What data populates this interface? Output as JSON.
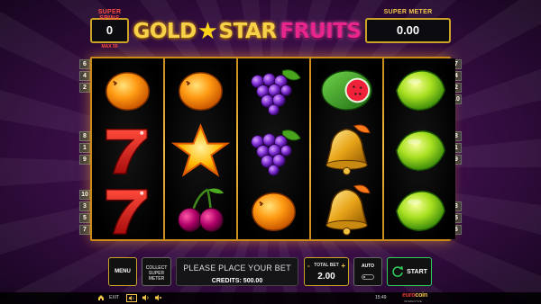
{
  "header": {
    "super_spins_label": "SUPER SPINS",
    "super_spins_value": "0",
    "max_spins_note": "MAX 50",
    "logo_part1": "GOLD",
    "logo_star": "★",
    "logo_part2": "STAR",
    "logo_part3": "FRUITS",
    "super_meter_label": "SUPER METER",
    "super_meter_value": "0.00"
  },
  "paylines": {
    "left": [
      "6",
      "4",
      "2",
      "8",
      "1",
      "9",
      "10",
      "3",
      "5",
      "7"
    ],
    "right": [
      "7",
      "4",
      "2",
      "10",
      "8",
      "1",
      "9",
      "3",
      "5",
      "6"
    ]
  },
  "reels": [
    [
      "orange",
      "seven",
      "seven"
    ],
    [
      "orange",
      "star",
      "cherries"
    ],
    [
      "grapes",
      "grapes",
      "orange"
    ],
    [
      "watermelon",
      "bell",
      "bell"
    ],
    [
      "lemon",
      "lemon",
      "lemon"
    ]
  ],
  "controls": {
    "menu_label": "MENU",
    "collect_label_1": "COLLECT",
    "collect_label_2": "SUPER",
    "collect_label_3": "METER",
    "message": "PLEASE PLACE YOUR BET",
    "credits_label": "CREDITS:",
    "credits_value": "500.00",
    "total_bet_label": "TOTAL BET",
    "bet_minus": "-",
    "bet_plus": "+",
    "total_bet_value": "2.00",
    "auto_label": "AUTO",
    "start_label": "START"
  },
  "status_bar": {
    "home_icon": "home-icon",
    "exit_label": "EXIT",
    "sound_icon": "speaker-icon",
    "time": "15:49",
    "brand_part1": "euro",
    "brand_part2": "coin",
    "brand_sub": "INTERACTIVE"
  },
  "colors": {
    "frame_gold": "#c98a1a",
    "accent_red": "#ff4b3b",
    "start_green": "#2ecc5a"
  }
}
